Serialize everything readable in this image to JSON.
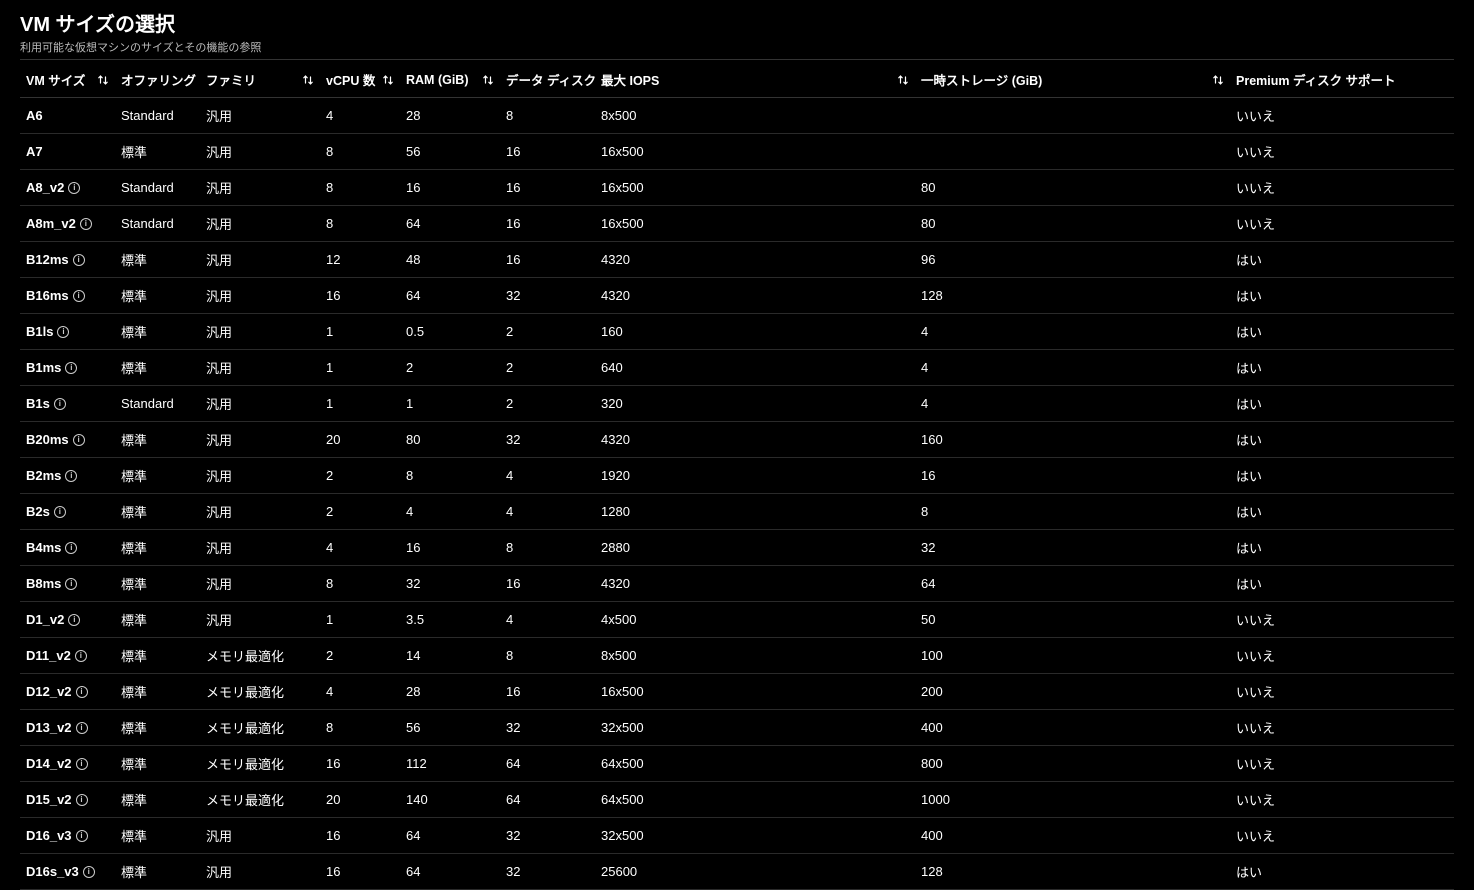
{
  "header": {
    "title": "VM サイズの選択",
    "subtitle": "利用可能な仮想マシンのサイズとその機能の参照"
  },
  "columns": {
    "vmsize": {
      "label": "VM サイズ",
      "sortable": true
    },
    "offering": {
      "label": "オファリング",
      "sortable": true
    },
    "family": {
      "label": "ファミリ",
      "sortable": true
    },
    "vcpu": {
      "label": "vCPU 数",
      "sortable": true
    },
    "ram": {
      "label": "RAM (GiB)",
      "sortable": true
    },
    "disk": {
      "label": "データ ディスク",
      "sortable": true
    },
    "iops": {
      "label": "最大 IOPS",
      "sortable": true
    },
    "temp": {
      "label": "一時ストレージ (GiB)",
      "sortable": true
    },
    "premium": {
      "label": "Premium ディスク サポート",
      "sortable": false
    }
  },
  "rows": [
    {
      "name": "A6",
      "info": false,
      "offering": "Standard",
      "family": "汎用",
      "vcpu": "4",
      "ram": "28",
      "disk": "8",
      "iops": "8x500",
      "temp": "",
      "premium": "いいえ"
    },
    {
      "name": "A7",
      "info": false,
      "offering": "標準",
      "family": "汎用",
      "vcpu": "8",
      "ram": "56",
      "disk": "16",
      "iops": "16x500",
      "temp": "",
      "premium": "いいえ"
    },
    {
      "name": "A8_v2",
      "info": true,
      "offering": "Standard",
      "family": "汎用",
      "vcpu": "8",
      "ram": "16",
      "disk": "16",
      "iops": "16x500",
      "temp": "80",
      "premium": "いいえ"
    },
    {
      "name": "A8m_v2",
      "info": true,
      "offering": "Standard",
      "family": "汎用",
      "vcpu": "8",
      "ram": "64",
      "disk": "16",
      "iops": "16x500",
      "temp": "80",
      "premium": "いいえ"
    },
    {
      "name": "B12ms",
      "info": true,
      "offering": "標準",
      "family": "汎用",
      "vcpu": "12",
      "ram": "48",
      "disk": "16",
      "iops": "4320",
      "temp": "96",
      "premium": "はい"
    },
    {
      "name": "B16ms",
      "info": true,
      "offering": "標準",
      "family": "汎用",
      "vcpu": "16",
      "ram": "64",
      "disk": "32",
      "iops": "4320",
      "temp": "128",
      "premium": "はい"
    },
    {
      "name": "B1ls",
      "info": true,
      "offering": "標準",
      "family": "汎用",
      "vcpu": "1",
      "ram": "0.5",
      "disk": "2",
      "iops": "160",
      "temp": "4",
      "premium": "はい"
    },
    {
      "name": "B1ms",
      "info": true,
      "offering": "標準",
      "family": "汎用",
      "vcpu": "1",
      "ram": "2",
      "disk": "2",
      "iops": "640",
      "temp": "4",
      "premium": "はい"
    },
    {
      "name": "B1s",
      "info": true,
      "offering": "Standard",
      "family": "汎用",
      "vcpu": "1",
      "ram": "1",
      "disk": "2",
      "iops": "320",
      "temp": "4",
      "premium": "はい"
    },
    {
      "name": "B20ms",
      "info": true,
      "offering": "標準",
      "family": "汎用",
      "vcpu": "20",
      "ram": "80",
      "disk": "32",
      "iops": "4320",
      "temp": "160",
      "premium": "はい"
    },
    {
      "name": "B2ms",
      "info": true,
      "offering": "標準",
      "family": "汎用",
      "vcpu": "2",
      "ram": "8",
      "disk": "4",
      "iops": "1920",
      "temp": "16",
      "premium": "はい"
    },
    {
      "name": "B2s",
      "info": true,
      "offering": "標準",
      "family": "汎用",
      "vcpu": "2",
      "ram": "4",
      "disk": "4",
      "iops": "1280",
      "temp": "8",
      "premium": "はい"
    },
    {
      "name": "B4ms",
      "info": true,
      "offering": "標準",
      "family": "汎用",
      "vcpu": "4",
      "ram": "16",
      "disk": "8",
      "iops": "2880",
      "temp": "32",
      "premium": "はい"
    },
    {
      "name": "B8ms",
      "info": true,
      "offering": "標準",
      "family": "汎用",
      "vcpu": "8",
      "ram": "32",
      "disk": "16",
      "iops": "4320",
      "temp": "64",
      "premium": "はい"
    },
    {
      "name": "D1_v2",
      "info": true,
      "offering": "標準",
      "family": "汎用",
      "vcpu": "1",
      "ram": "3.5",
      "disk": "4",
      "iops": "4x500",
      "temp": "50",
      "premium": "いいえ"
    },
    {
      "name": "D11_v2",
      "info": true,
      "offering": "標準",
      "family": "メモリ最適化",
      "vcpu": "2",
      "ram": "14",
      "disk": "8",
      "iops": "8x500",
      "temp": "100",
      "premium": "いいえ"
    },
    {
      "name": "D12_v2",
      "info": true,
      "offering": "標準",
      "family": "メモリ最適化",
      "vcpu": "4",
      "ram": "28",
      "disk": "16",
      "iops": "16x500",
      "temp": "200",
      "premium": "いいえ"
    },
    {
      "name": "D13_v2",
      "info": true,
      "offering": "標準",
      "family": "メモリ最適化",
      "vcpu": "8",
      "ram": "56",
      "disk": "32",
      "iops": "32x500",
      "temp": "400",
      "premium": "いいえ"
    },
    {
      "name": "D14_v2",
      "info": true,
      "offering": "標準",
      "family": "メモリ最適化",
      "vcpu": "16",
      "ram": "112",
      "disk": "64",
      "iops": "64x500",
      "temp": "800",
      "premium": "いいえ"
    },
    {
      "name": "D15_v2",
      "info": true,
      "offering": "標準",
      "family": "メモリ最適化",
      "vcpu": "20",
      "ram": "140",
      "disk": "64",
      "iops": "64x500",
      "temp": "1000",
      "premium": "いいえ"
    },
    {
      "name": "D16_v3",
      "info": true,
      "offering": "標準",
      "family": "汎用",
      "vcpu": "16",
      "ram": "64",
      "disk": "32",
      "iops": "32x500",
      "temp": "400",
      "premium": "いいえ"
    },
    {
      "name": "D16s_v3",
      "info": true,
      "offering": "標準",
      "family": "汎用",
      "vcpu": "16",
      "ram": "64",
      "disk": "32",
      "iops": "25600",
      "temp": "128",
      "premium": "はい"
    }
  ]
}
